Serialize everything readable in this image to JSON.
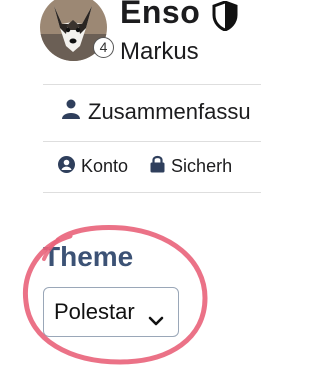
{
  "profile": {
    "username": "Enso",
    "full_name": "Markus",
    "notification_count": "4",
    "avatar_icon": "dog-avatar",
    "verified_icon": "shield-icon"
  },
  "nav": {
    "summary_label": "Zusammenfassu",
    "summary_icon": "user-icon"
  },
  "tabs": [
    {
      "label": "Konto",
      "icon": "user-circle-icon"
    },
    {
      "label": "Sicherh",
      "icon": "lock-icon"
    }
  ],
  "theme": {
    "label": "Theme",
    "selected": "Polestar"
  },
  "colors": {
    "theme_label": "#3c5275",
    "icon": "#2f3f5c",
    "annotation_circle": "#e9637a"
  }
}
